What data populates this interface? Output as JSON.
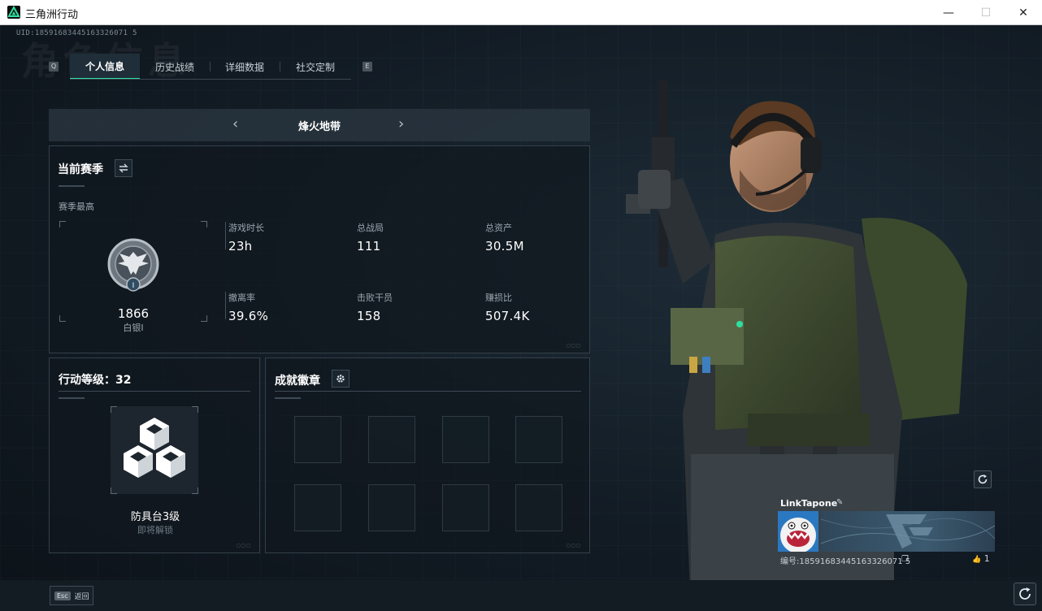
{
  "window": {
    "title": "三角洲行动",
    "minimize": "—",
    "maximize": "☐",
    "close": "✕"
  },
  "uid": "UID:18591683445163326071 5",
  "watermark": "角色信息",
  "tabs": {
    "left_key": "Q",
    "right_key": "E",
    "items": [
      {
        "label": "个人信息",
        "active": true
      },
      {
        "label": "历史战绩",
        "active": false
      },
      {
        "label": "详细数据",
        "active": false
      },
      {
        "label": "社交定制",
        "active": false
      }
    ]
  },
  "mode": {
    "title": "烽火地带",
    "prev": "‹",
    "next": "›"
  },
  "season": {
    "title": "当前赛季",
    "best_label": "赛季最高",
    "rank_score": "1866",
    "rank_name": "白银I",
    "rank_tier": "I",
    "stats": [
      {
        "label": "游戏时长",
        "value": "23h"
      },
      {
        "label": "总战局",
        "value": "111"
      },
      {
        "label": "总资产",
        "value": "30.5M"
      },
      {
        "label": "撤离率",
        "value": "39.6%"
      },
      {
        "label": "击败干员",
        "value": "158"
      },
      {
        "label": "赚损比",
        "value": "507.4K"
      }
    ]
  },
  "level": {
    "title": "行动等级：32",
    "item_name": "防具台3级",
    "item_status": "即将解锁"
  },
  "badges": {
    "title": "成就徽章"
  },
  "profile": {
    "name": "LinkTapone",
    "edit_icon": "✎",
    "id_label": "编号:18591683445163326071 5",
    "copy_icon": "❐",
    "likes": "1",
    "like_icon": "👍"
  },
  "bottom": {
    "esc_key": "Esc",
    "esc_label": "返回"
  },
  "colors": {
    "accent": "#2ee0a0",
    "background": "#121b24"
  }
}
